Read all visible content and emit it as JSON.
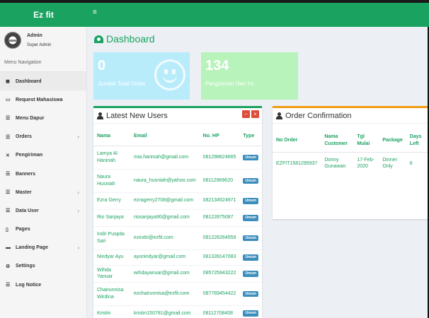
{
  "app": {
    "brand": "Ez fit",
    "menu_toggle": "≡"
  },
  "user": {
    "name": "Admin",
    "role": "Super Admin"
  },
  "sidebar": {
    "header": "Menu Navigation",
    "items": [
      {
        "label": "Dashboard",
        "icon": "dashboard-icon",
        "glyph": "◼",
        "chevron": ""
      },
      {
        "label": "Request Mahasiswa",
        "icon": "credit-card-icon",
        "glyph": "▭",
        "chevron": ""
      },
      {
        "label": "Menu Dapur",
        "icon": "list-icon",
        "glyph": "☰",
        "chevron": ""
      },
      {
        "label": "Orders",
        "icon": "list-icon",
        "glyph": "☰",
        "chevron": "›"
      },
      {
        "label": "Pengiriman",
        "icon": "shuffle-icon",
        "glyph": "✕",
        "chevron": ""
      },
      {
        "label": "Banners",
        "icon": "list-icon",
        "glyph": "☰",
        "chevron": ""
      },
      {
        "label": "Master",
        "icon": "list-icon",
        "glyph": "☰",
        "chevron": "›"
      },
      {
        "label": "Data User",
        "icon": "list-icon",
        "glyph": "☰",
        "chevron": "›"
      },
      {
        "label": "Pages",
        "icon": "file-icon",
        "glyph": "▯",
        "chevron": ""
      },
      {
        "label": "Landing Page",
        "icon": "folder-icon",
        "glyph": "▬",
        "chevron": "›"
      },
      {
        "label": "Settings",
        "icon": "gears-icon",
        "glyph": "⚙",
        "chevron": ""
      },
      {
        "label": "Log Notice",
        "icon": "list-icon",
        "glyph": "☰",
        "chevron": ""
      }
    ]
  },
  "page": {
    "title": "Dashboard"
  },
  "stats": [
    {
      "value": "0",
      "label": "Jumlah Total Order",
      "color": "#b9ecfb"
    },
    {
      "value": "134",
      "label": "Pengiriman Hari Ini",
      "color": "#b7f3bb"
    }
  ],
  "latest_users": {
    "title": "Latest New Users",
    "tool_minimize": "−",
    "tool_close": "×",
    "columns": [
      "Nama",
      "Email",
      "No. HP",
      "Type"
    ],
    "rows": [
      {
        "name": "Lamya Al Haninah",
        "email": "mia.haninah@gmail.com",
        "phone": "081298624665",
        "type": "Umum"
      },
      {
        "name": "Naura Husniah",
        "email": "naura_husniah@yahoo.com",
        "phone": "08112969620",
        "type": "Umum"
      },
      {
        "name": "Ezra Gerry",
        "email": "ezragerry2708@gmail.com",
        "phone": "082134524971",
        "type": "Umum"
      },
      {
        "name": "Rio Sanjaya",
        "email": "riosanjaya90@gmail.com",
        "phone": "08122875087",
        "type": "Umum"
      },
      {
        "name": "Indri Puspita Sari",
        "email": "ezindri@ezfit.com",
        "phone": "081226264559",
        "type": "Umum"
      },
      {
        "name": "Nindyar Ayu",
        "email": "ayunindyar@gmail.com",
        "phone": "081339147083",
        "type": "Umum"
      },
      {
        "name": "Wihda Yanuar",
        "email": "wihdayanuar@gmail.com",
        "phone": "085725943222",
        "type": "Umum"
      },
      {
        "name": "Chairunnisa Wirdina",
        "email": "ezchairunnisa@ezfit.com",
        "phone": "087769454422",
        "type": "Umum"
      },
      {
        "name": "Kristin",
        "email": "kristin150781@gmail.com",
        "phone": "08112708408",
        "type": "Umum"
      }
    ]
  },
  "order_confirmation": {
    "title": "Order Confirmation",
    "columns": [
      "No Order",
      "Nama Customer",
      "Tgl Mulai",
      "Package",
      "Days Left"
    ],
    "rows": [
      {
        "no_order": "EZFIT1581295937",
        "customer": "Donny Gunawan",
        "start": "17-Feb-2020",
        "package": "Dinner Only",
        "days_left": "6"
      }
    ]
  },
  "colors": {
    "brand": "#1aa260",
    "badge": "#3c8dbc",
    "danger": "#dd4b39",
    "warning": "#f39c12"
  }
}
